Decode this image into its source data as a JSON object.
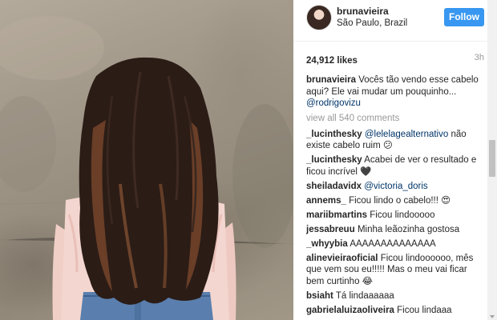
{
  "post": {
    "username": "brunavieira",
    "location": "São Paulo, Brazil",
    "follow_label": "Follow",
    "likes": "24,912 likes",
    "time": "3h",
    "caption": {
      "user": "brunavieira",
      "text": "Vocês tão vendo esse cabelo aqui? Ele vai mudar um pouquinho...",
      "mention": "@rodrigovizu"
    },
    "view_all": "view all 540 comments"
  },
  "comments": [
    {
      "user": "_lucinthesky",
      "mention": "@lelelagealternativo",
      "text": "não existe cabelo ruim 😕"
    },
    {
      "user": "_lucinthesky",
      "mention": "",
      "text": "Acabei de ver o resultado e ficou incrível 🖤"
    },
    {
      "user": "sheiladavidx",
      "mention": "@victoria_doris",
      "text": ""
    },
    {
      "user": "annems_",
      "mention": "",
      "text": "Ficou lindo o cabelo!!! 😍"
    },
    {
      "user": "mariibmartins",
      "mention": "",
      "text": "Ficou lindooooo"
    },
    {
      "user": "jessabreuu",
      "mention": "",
      "text": "Minha leãozinha gostosa"
    },
    {
      "user": "_whyybia",
      "mention": "",
      "text": "AAAAAAAAAAAAAA"
    },
    {
      "user": "alinevieiraoficial",
      "mention": "",
      "text": "Ficou lindoooooo, mês que vem sou eu!!!!! Mas o meu vai ficar bem curtinho 😂"
    },
    {
      "user": "bsiaht",
      "mention": "",
      "text": "Tá lindaaaaaa"
    },
    {
      "user": "gabrielaluizaoliveira",
      "mention": "",
      "text": "Ficou lindaaa"
    }
  ],
  "colors": {
    "follow": "#3897f0",
    "mention": "#003569",
    "muted": "#999999"
  },
  "icons": {
    "scroll_down": "triangle-down-icon"
  }
}
